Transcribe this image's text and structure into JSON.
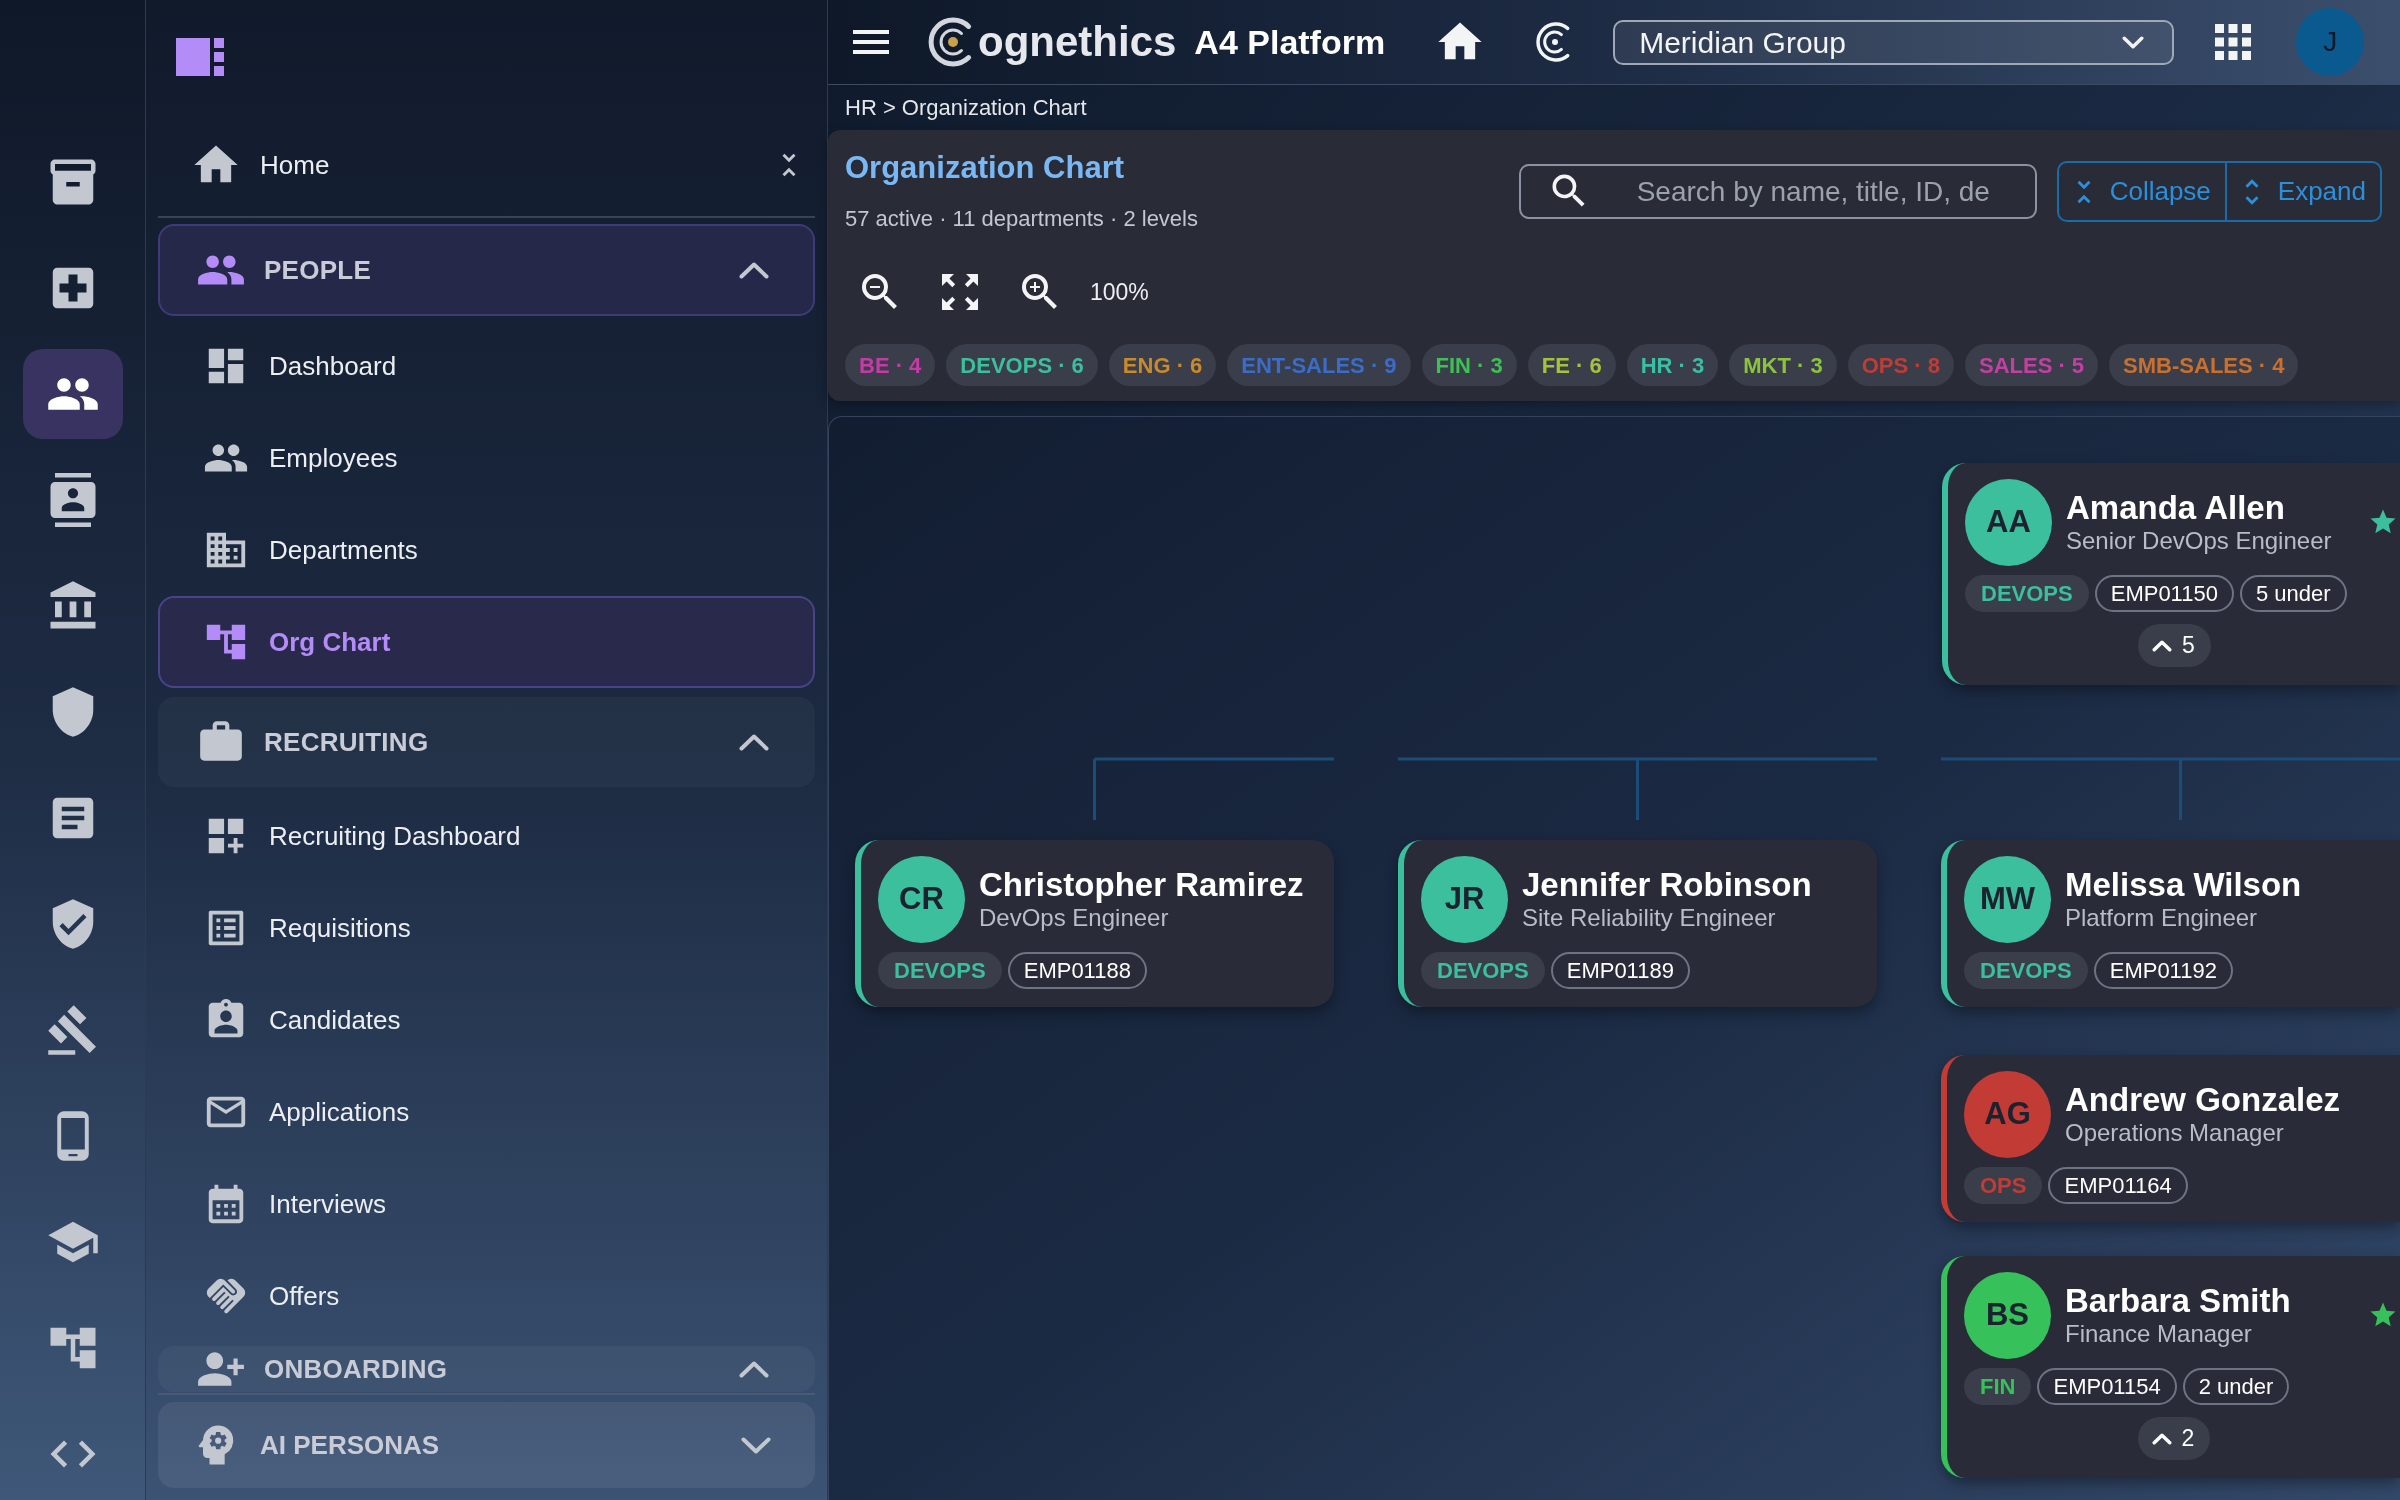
{
  "icon_rail": [
    {
      "selected": false
    },
    {
      "selected": false
    },
    {
      "selected": true
    },
    {
      "selected": false
    },
    {
      "selected": false
    },
    {
      "selected": false
    },
    {
      "selected": false
    },
    {
      "selected": false
    },
    {
      "selected": false
    },
    {
      "selected": false
    },
    {
      "selected": false
    },
    {
      "selected": false
    },
    {
      "selected": false
    }
  ],
  "sidebar": {
    "home": "Home",
    "groups": [
      {
        "label": "PEOPLE",
        "active": true,
        "expanded": true,
        "items": [
          {
            "label": "Dashboard",
            "selected": false
          },
          {
            "label": "Employees",
            "selected": false
          },
          {
            "label": "Departments",
            "selected": false
          },
          {
            "label": "Org Chart",
            "selected": true
          }
        ]
      },
      {
        "label": "RECRUITING",
        "active": false,
        "expanded": true,
        "items": [
          {
            "label": "Recruiting Dashboard",
            "selected": false
          },
          {
            "label": "Requisitions",
            "selected": false
          },
          {
            "label": "Candidates",
            "selected": false
          },
          {
            "label": "Applications",
            "selected": false
          },
          {
            "label": "Interviews",
            "selected": false
          },
          {
            "label": "Offers",
            "selected": false
          }
        ]
      },
      {
        "label": "ONBOARDING",
        "active": false,
        "expanded": true
      }
    ],
    "footer_group": {
      "label": "AI PERSONAS",
      "expanded": false
    }
  },
  "top_bar": {
    "logo_text": "ognethics",
    "product": "A4 Platform",
    "organization": "Meridian Group",
    "avatar": "J"
  },
  "breadcrumb": "HR > Organization Chart",
  "header": {
    "title": "Organization Chart",
    "summary": "57 active · 11 departments · 2 levels",
    "search": {
      "placeholder": "Search by name, title, ID, de"
    },
    "buttons": [
      "Collapse",
      "Expand"
    ],
    "zoom": "100%",
    "departments": [
      {
        "label": "BE · 4",
        "color": "#c63aa6"
      },
      {
        "label": "DEVOPS · 6",
        "color": "#3cbf9c"
      },
      {
        "label": "ENG · 6",
        "color": "#c98a2c"
      },
      {
        "label": "ENT-SALES · 9",
        "color": "#3a6cc8"
      },
      {
        "label": "FIN · 3",
        "color": "#3cc152"
      },
      {
        "label": "FE · 6",
        "color": "#a6c23a"
      },
      {
        "label": "HR · 3",
        "color": "#3bbfa4"
      },
      {
        "label": "MKT · 3",
        "color": "#8cc33c"
      },
      {
        "label": "OPS · 8",
        "color": "#c23b35"
      },
      {
        "label": "SALES · 5",
        "color": "#c43fa2"
      },
      {
        "label": "SMB-SALES · 4",
        "color": "#c9702e"
      }
    ]
  },
  "org_chart": {
    "roots": [
      {
        "initials": "AA",
        "name": "Amanda Allen",
        "title": "Senior DevOps Engineer",
        "department": "DEVOPS",
        "employee_id": "EMP01150",
        "reports": "5 under",
        "starred": true,
        "color": "#3cbf9c",
        "toggle": {
          "count": "5",
          "expanded": true
        },
        "children": [
          {
            "initials": "CR",
            "name": "Christopher Ramirez",
            "title": "DevOps Engineer",
            "department": "DEVOPS",
            "employee_id": "EMP01188",
            "starred": false,
            "color": "#3cbf9c"
          },
          {
            "initials": "JR",
            "name": "Jennifer Robinson",
            "title": "Site Reliability Engineer",
            "department": "DEVOPS",
            "employee_id": "EMP01189",
            "starred": false,
            "color": "#3cbf9c"
          },
          {
            "initials": "MW",
            "name": "Melissa Wilson",
            "title": "Platform Engineer",
            "department": "DEVOPS",
            "employee_id": "EMP01192",
            "starred": false,
            "color": "#3cbf9c"
          }
        ]
      },
      {
        "initials": "AG",
        "name": "Andrew Gonzalez",
        "title": "Operations Manager",
        "department": "OPS",
        "employee_id": "EMP01164",
        "starred": false,
        "color": "#c23b35"
      },
      {
        "initials": "BS",
        "name": "Barbara Smith",
        "title": "Finance Manager",
        "department": "FIN",
        "employee_id": "EMP01154",
        "reports": "2 under",
        "starred": true,
        "color": "#36c15a",
        "toggle": {
          "count": "2",
          "expanded": true
        }
      }
    ]
  }
}
